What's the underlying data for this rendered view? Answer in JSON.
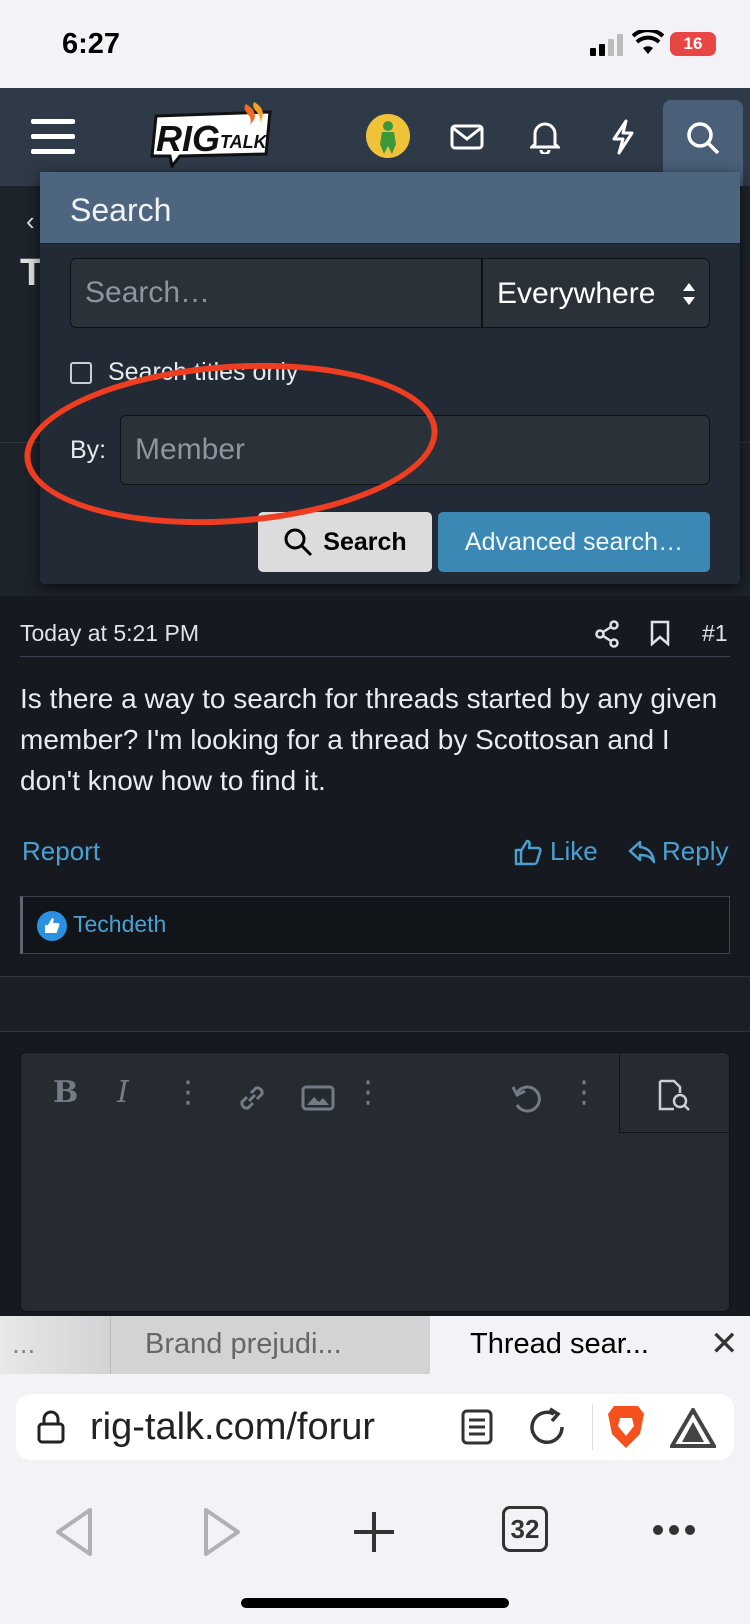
{
  "status_bar": {
    "time": "6:27",
    "battery": "16"
  },
  "header": {
    "logo_text": "RIG",
    "logo_sub": "TALK"
  },
  "search_menu": {
    "title": "Search",
    "search_placeholder": "Search…",
    "scope_value": "Everywhere",
    "titles_only_label": "Search titles only",
    "by_label": "By:",
    "member_placeholder": "Member",
    "search_button": "Search",
    "advanced_button": "Advanced search…"
  },
  "behind": {
    "title_initial": "T"
  },
  "post": {
    "timestamp": "Today at 5:21 PM",
    "number": "#1",
    "body": "Is there a way to search for threads started by any given member? I'm looking for a thread by Scottosan and I don't know how to find it.",
    "report_label": "Report",
    "like_label": "Like",
    "reply_label": "Reply",
    "reaction_user": "Techdeth"
  },
  "browser": {
    "tab_overflow": "...",
    "tab_brand": "Brand prejudi...",
    "tab_active": "Thread sear...",
    "url": "rig-talk.com/forur",
    "tab_count": "32"
  },
  "colors": {
    "accent": "#3b88b5",
    "annotation": "#ef3d22",
    "header": "#2f3a48"
  }
}
